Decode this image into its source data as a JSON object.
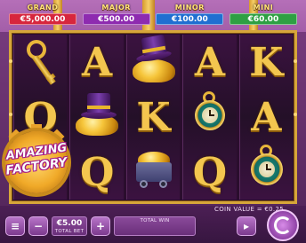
{
  "jackpots": [
    {
      "title": "GRAND",
      "value": "€5,000.00",
      "color": "#d7263d"
    },
    {
      "title": "MAJOR",
      "value": "€500.00",
      "color": "#8e2bb0"
    },
    {
      "title": "MINOR",
      "value": "€100.00",
      "color": "#1f6fd1"
    },
    {
      "title": "MINI",
      "value": "€60.00",
      "color": "#2ea043"
    }
  ],
  "reels": [
    [
      "key",
      "Q",
      "logo"
    ],
    [
      "A",
      "top-hat-gold",
      "Q"
    ],
    [
      "top-hat-gold",
      "K",
      "mine-cart"
    ],
    [
      "A",
      "pocket-watch",
      "Q"
    ],
    [
      "K",
      "A",
      "pocket-watch"
    ]
  ],
  "logo": {
    "line1": "AMAZING",
    "line2": "FACTORY"
  },
  "footer": {
    "coin_value": "COIN VALUE = €0.25",
    "bet_value": "€5.00",
    "bet_label": "TOTAL BET",
    "minus": "−",
    "plus": "+",
    "win_label": "TOTAL WIN",
    "menu": "≡",
    "autoplay": "▸"
  }
}
